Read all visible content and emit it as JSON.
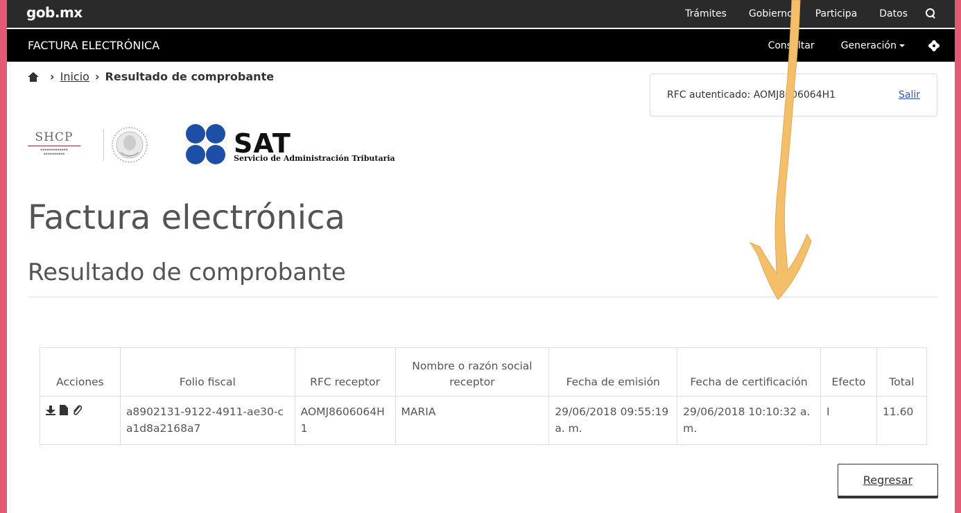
{
  "gob_header": {
    "logo": "gob.mx",
    "nav": [
      "Trámites",
      "Gobierno",
      "Participa",
      "Datos"
    ]
  },
  "sub_header": {
    "title": "FACTURA ELECTRÓNICA",
    "consult_label": "Consultar",
    "generation_label": "Generación"
  },
  "breadcrumb": {
    "home_label": "Inicio",
    "current": "Resultado de comprobante"
  },
  "auth": {
    "rfc_label": "RFC autenticado: AOMJ8606064H1",
    "logout_label": "Salir"
  },
  "logos": {
    "shcp": "SHCP",
    "sat": "SAT",
    "sat_subtitle": "Servicio de Administración Tributaria"
  },
  "page": {
    "title": "Factura electrónica",
    "subtitle": "Resultado de comprobante"
  },
  "table": {
    "headers": [
      "Acciones",
      "Folio fiscal",
      "RFC receptor",
      "Nombre o razón social receptor",
      "Fecha de emisión",
      "Fecha de certificación",
      "Efecto",
      "Total"
    ],
    "rows": [
      {
        "folio": "a8902131-9122-4911-ae30-ca1d8a2168a7",
        "rfc": "AOMJ8606064H1",
        "nombre": "MARIA",
        "fecha_emision": "29/06/2018 09:55:19 a. m.",
        "fecha_certificacion": "29/06/2018 10:10:32 a. m.",
        "efecto": "I",
        "total": "11.60"
      }
    ]
  },
  "back_button_label": "Regresar",
  "colors": {
    "frame_pink": "#e35a72",
    "top_bar": "#2a2a2a",
    "sub_bar": "#000000",
    "link_blue": "#2f55c5",
    "arrow_annotation": "#f3bf6a"
  }
}
